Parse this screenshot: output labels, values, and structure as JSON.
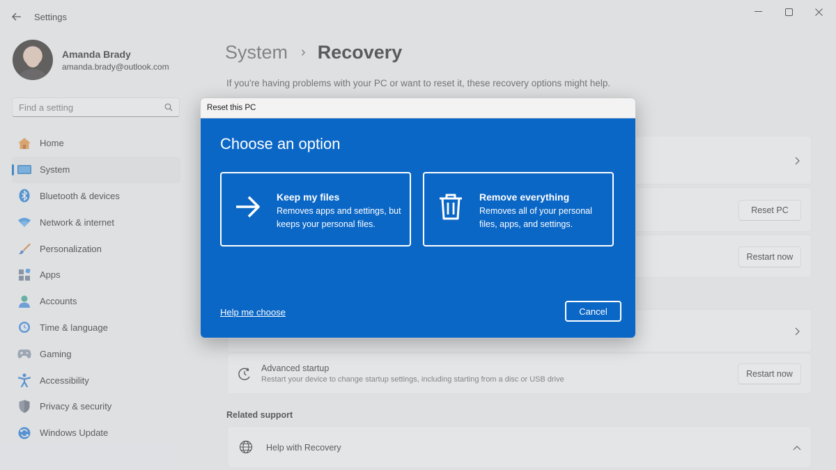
{
  "app": {
    "title": "Settings"
  },
  "profile": {
    "name": "Amanda Brady",
    "email": "amanda.brady@outlook.com"
  },
  "search": {
    "placeholder": "Find a setting"
  },
  "sidebar": {
    "items": [
      {
        "label": "Home",
        "icon": "home-icon"
      },
      {
        "label": "System",
        "icon": "system-icon",
        "selected": true
      },
      {
        "label": "Bluetooth & devices",
        "icon": "bluetooth-icon"
      },
      {
        "label": "Network & internet",
        "icon": "wifi-icon"
      },
      {
        "label": "Personalization",
        "icon": "brush-icon"
      },
      {
        "label": "Apps",
        "icon": "apps-icon"
      },
      {
        "label": "Accounts",
        "icon": "account-icon"
      },
      {
        "label": "Time & language",
        "icon": "clock-globe-icon"
      },
      {
        "label": "Gaming",
        "icon": "controller-icon"
      },
      {
        "label": "Accessibility",
        "icon": "accessibility-icon"
      },
      {
        "label": "Privacy & security",
        "icon": "shield-icon"
      },
      {
        "label": "Windows Update",
        "icon": "update-icon"
      }
    ]
  },
  "main": {
    "breadcrumb": {
      "parent": "System",
      "current": "Recovery"
    },
    "intro": "If you're having problems with your PC or want to reset it, these recovery options might help.",
    "reset_button": "Reset PC",
    "restart_button": "Restart now",
    "advanced_startup": {
      "title": "Advanced startup",
      "subtitle": "Restart your device to change startup settings, including starting from a disc or USB drive",
      "button": "Restart now"
    },
    "related_support": {
      "heading": "Related support",
      "item": "Help with Recovery"
    }
  },
  "dialog": {
    "title": "Reset this PC",
    "heading": "Choose an option",
    "options": [
      {
        "title": "Keep my files",
        "description": "Removes apps and settings, but keeps your personal files.",
        "icon": "arrow-right-icon"
      },
      {
        "title": "Remove everything",
        "description": "Removes all of your personal files, apps, and settings.",
        "icon": "trash-icon"
      }
    ],
    "help_link": "Help me choose",
    "cancel": "Cancel"
  },
  "colors": {
    "accent": "#0067c0",
    "dialog_background": "#0b67c6"
  }
}
